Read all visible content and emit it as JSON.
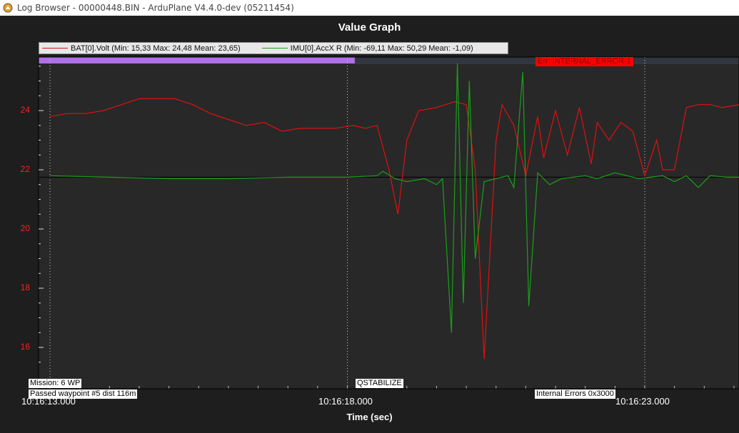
{
  "window": {
    "title": "Log Browser - 00000448.BIN - ArduPlane V4.4.0-dev (05211454)",
    "icon": "log-browser-app-icon"
  },
  "graph": {
    "title": "Value Graph",
    "xlabel": "Time (sec)",
    "background": "#1e1e1e",
    "legend": [
      {
        "name": "BAT[0].Volt  (Min: 15,33 Max: 24,48 Mean: 23,65)",
        "color": "#e01010"
      },
      {
        "name": "IMU[0].AccX  R (Min: -69,11 Max: 50,29 Mean: -1,09)",
        "color": "#1aa01a"
      }
    ],
    "mode_labels": [
      {
        "text": "Mission: 6 WP"
      },
      {
        "text": "Passed waypoint #5 dist 116m"
      },
      {
        "text": "QSTABILIZE"
      },
      {
        "text": "Internal Errors 0x3000"
      }
    ],
    "error_label": "Err: INTERNAL_ERROR-1",
    "x_ticks": [
      "10:16:13.000",
      "10:16:18.000",
      "10:16:23.000"
    ],
    "y_ticks": [
      "24",
      "22",
      "20",
      "18",
      "16"
    ]
  },
  "chart_data": {
    "type": "line",
    "title": "Value Graph",
    "xlabel": "Time (sec)",
    "x_unit": "seconds since 10:16:13.000",
    "xlim": [
      13.0,
      24.6
    ],
    "ylim": [
      15.0,
      26.0
    ],
    "series": [
      {
        "name": "BAT[0].Volt  (Min: 15,33 Max: 24,48 Mean: 23,65)",
        "color": "#e01010",
        "x": [
          13.0,
          13.3,
          13.6,
          13.9,
          14.2,
          14.5,
          14.8,
          15.1,
          15.4,
          15.7,
          16.0,
          16.3,
          16.6,
          16.9,
          17.2,
          17.5,
          17.8,
          18.1,
          18.3,
          18.5,
          18.7,
          18.85,
          19.0,
          19.2,
          19.5,
          19.8,
          20.0,
          20.15,
          20.3,
          20.5,
          20.6,
          20.8,
          21.0,
          21.2,
          21.3,
          21.5,
          21.7,
          21.9,
          22.1,
          22.2,
          22.4,
          22.6,
          22.8,
          23.0,
          23.2,
          23.3,
          23.5,
          23.7,
          23.9,
          24.1,
          24.3,
          24.6
        ],
        "y": [
          23.8,
          23.9,
          23.9,
          24.0,
          24.2,
          24.4,
          24.4,
          24.4,
          24.2,
          23.9,
          23.7,
          23.5,
          23.6,
          23.3,
          23.4,
          23.4,
          23.4,
          23.5,
          23.4,
          23.5,
          22.0,
          20.5,
          23.0,
          24.0,
          24.1,
          24.3,
          24.2,
          22.0,
          15.6,
          23.0,
          24.2,
          23.5,
          21.8,
          23.8,
          22.4,
          24.0,
          22.5,
          24.1,
          22.2,
          23.6,
          23.0,
          23.6,
          23.3,
          21.8,
          23.0,
          22.0,
          22.0,
          24.1,
          24.2,
          24.2,
          24.1,
          24.2
        ]
      },
      {
        "name": "IMU[0].AccX  R (Min: -69,11 Max: 50,29 Mean: -1,09)",
        "color": "#1aa01a",
        "x": [
          13.0,
          14.0,
          15.0,
          16.0,
          17.0,
          18.0,
          18.5,
          18.6,
          18.8,
          19.0,
          19.3,
          19.5,
          19.6,
          19.75,
          19.85,
          19.95,
          20.05,
          20.15,
          20.3,
          20.5,
          20.7,
          20.8,
          20.95,
          21.05,
          21.2,
          21.4,
          21.6,
          22.0,
          22.2,
          22.5,
          22.7,
          22.9,
          23.1,
          23.3,
          23.5,
          23.7,
          23.9,
          24.1,
          24.4,
          24.6
        ],
        "y": [
          21.8,
          21.75,
          21.7,
          21.7,
          21.75,
          21.75,
          21.8,
          21.95,
          21.7,
          21.6,
          21.7,
          21.5,
          21.7,
          16.5,
          25.6,
          17.5,
          25.0,
          19.0,
          21.6,
          21.7,
          21.8,
          21.4,
          25.3,
          17.4,
          21.9,
          21.5,
          21.7,
          21.8,
          21.7,
          21.9,
          21.8,
          21.7,
          21.75,
          21.8,
          21.6,
          21.8,
          21.4,
          21.8,
          21.75,
          21.75
        ]
      }
    ],
    "x_ticks": [
      "10:16:13.000",
      "10:16:18.000",
      "10:16:23.000"
    ],
    "y_ticks": [
      24,
      22,
      20,
      18,
      16
    ],
    "grid": "vertical dotted lines",
    "legend_position": "top"
  }
}
